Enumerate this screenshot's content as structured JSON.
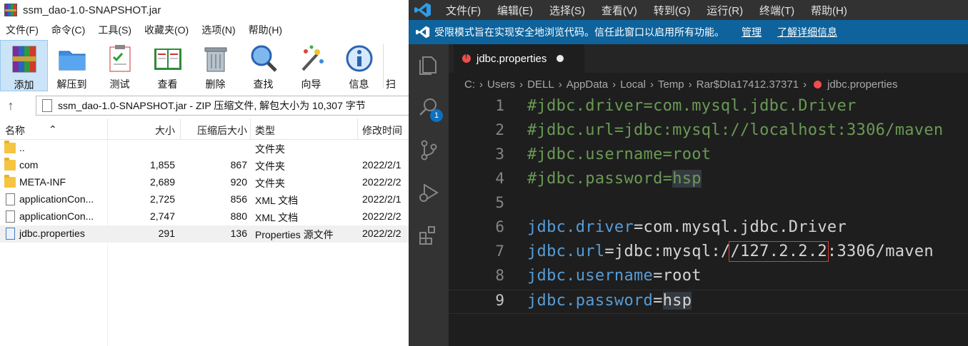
{
  "winrar": {
    "title": "ssm_dao-1.0-SNAPSHOT.jar",
    "menu": [
      "文件(F)",
      "命令(C)",
      "工具(S)",
      "收藏夹(O)",
      "选项(N)",
      "帮助(H)"
    ],
    "toolbar": [
      "添加",
      "解压到",
      "测试",
      "查看",
      "删除",
      "查找",
      "向导",
      "信息",
      "扫"
    ],
    "path": "ssm_dao-1.0-SNAPSHOT.jar - ZIP 压缩文件, 解包大小为 10,307 字节",
    "columns": {
      "name": "名称",
      "size": "大小",
      "packed": "压缩后大小",
      "type": "类型",
      "mtime": "修改时间"
    },
    "rows": [
      {
        "name": "..",
        "size": "",
        "packed": "",
        "type": "文件夹",
        "mtime": "",
        "icon": "folder-icon"
      },
      {
        "name": "com",
        "size": "1,855",
        "packed": "867",
        "type": "文件夹",
        "mtime": "2022/2/1",
        "icon": "folder-icon"
      },
      {
        "name": "META-INF",
        "size": "2,689",
        "packed": "920",
        "type": "文件夹",
        "mtime": "2022/2/2",
        "icon": "folder-icon"
      },
      {
        "name": "applicationCon...",
        "size": "2,725",
        "packed": "856",
        "type": "XML 文档",
        "mtime": "2022/2/1",
        "icon": "file-icon"
      },
      {
        "name": "applicationCon...",
        "size": "2,747",
        "packed": "880",
        "type": "XML 文档",
        "mtime": "2022/2/2",
        "icon": "file-icon"
      },
      {
        "name": "jdbc.properties",
        "size": "291",
        "packed": "136",
        "type": "Properties 源文件",
        "mtime": "2022/2/2",
        "icon": "properties-file-icon"
      }
    ]
  },
  "vscode": {
    "menu": [
      "文件(F)",
      "编辑(E)",
      "选择(S)",
      "查看(V)",
      "转到(G)",
      "运行(R)",
      "终端(T)",
      "帮助(H)"
    ],
    "banner": {
      "message": "受限模式旨在实现安全地浏览代码。信任此窗口以启用所有功能。",
      "manage": "管理",
      "learn_more": "了解详细信息"
    },
    "badge": "1",
    "tab": "jdbc.properties",
    "breadcrumbs": [
      "C:",
      "Users",
      "DELL",
      "AppData",
      "Local",
      "Temp",
      "Rar$DIa17412.37371",
      "jdbc.properties"
    ],
    "lines": [
      {
        "n": "1",
        "parts": [
          [
            "comment",
            "#jdbc.driver=com.mysql.jdbc.Driver"
          ]
        ]
      },
      {
        "n": "2",
        "parts": [
          [
            "comment",
            "#jdbc.url=jdbc:mysql://localhost:3306/maven"
          ]
        ]
      },
      {
        "n": "3",
        "parts": [
          [
            "comment",
            "#jdbc.username=root"
          ]
        ]
      },
      {
        "n": "4",
        "parts": [
          [
            "comment",
            "#jdbc.password="
          ],
          [
            "comment hl",
            "hsp"
          ]
        ]
      },
      {
        "n": "5",
        "parts": []
      },
      {
        "n": "6",
        "parts": [
          [
            "key",
            "jdbc.driver"
          ],
          [
            "val",
            "=com.mysql.jdbc.Driver"
          ]
        ]
      },
      {
        "n": "7",
        "parts": [
          [
            "key",
            "jdbc.url"
          ],
          [
            "val",
            "=jdbc:mysql:/"
          ],
          [
            "val redbox",
            "/127.2.2.2"
          ],
          [
            "val",
            ":3306/maven"
          ]
        ]
      },
      {
        "n": "8",
        "parts": [
          [
            "key",
            "jdbc.username"
          ],
          [
            "val",
            "=root"
          ]
        ]
      },
      {
        "n": "9",
        "parts": [
          [
            "key",
            "jdbc.password"
          ],
          [
            "val",
            "="
          ],
          [
            "val hl",
            "hsp"
          ]
        ]
      }
    ],
    "current_line": "9"
  }
}
